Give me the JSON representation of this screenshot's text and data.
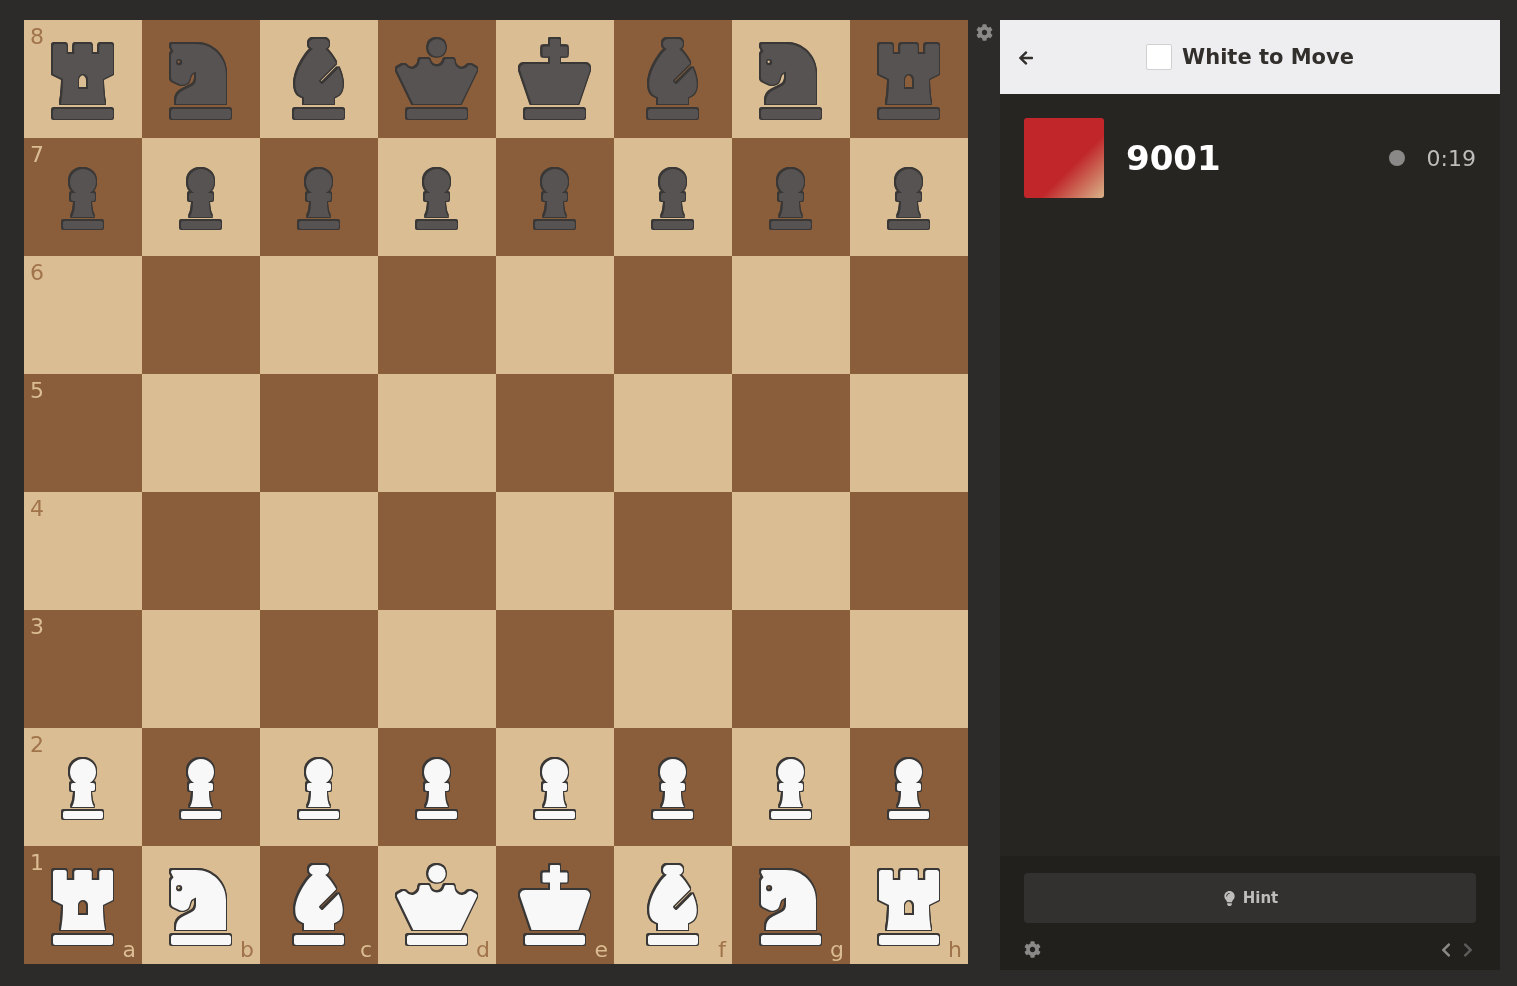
{
  "board": {
    "files": [
      "a",
      "b",
      "c",
      "d",
      "e",
      "f",
      "g",
      "h"
    ],
    "ranks": [
      {
        "label": "8",
        "squares": [
          {
            "kind": "black_rook"
          },
          {
            "kind": "black_knight"
          },
          {
            "kind": "black_bishop"
          },
          {
            "kind": "black_queen"
          },
          {
            "kind": "black_king"
          },
          {
            "kind": "black_bishop"
          },
          {
            "kind": "black_knight"
          },
          {
            "kind": "black_rook"
          }
        ]
      },
      {
        "label": "7",
        "squares": [
          {
            "kind": "black_pawn"
          },
          {
            "kind": "black_pawn"
          },
          {
            "kind": "black_pawn"
          },
          {
            "kind": "black_pawn"
          },
          {
            "kind": "black_pawn"
          },
          {
            "kind": "black_pawn"
          },
          {
            "kind": "black_pawn"
          },
          {
            "kind": "black_pawn"
          }
        ]
      },
      {
        "label": "6",
        "squares": [
          {
            "kind": "empty"
          },
          {
            "kind": "empty"
          },
          {
            "kind": "empty"
          },
          {
            "kind": "empty"
          },
          {
            "kind": "empty"
          },
          {
            "kind": "empty"
          },
          {
            "kind": "empty"
          },
          {
            "kind": "empty"
          }
        ]
      },
      {
        "label": "5",
        "squares": [
          {
            "kind": "empty"
          },
          {
            "kind": "empty"
          },
          {
            "kind": "empty"
          },
          {
            "kind": "empty"
          },
          {
            "kind": "empty"
          },
          {
            "kind": "empty"
          },
          {
            "kind": "empty"
          },
          {
            "kind": "empty"
          }
        ]
      },
      {
        "label": "4",
        "squares": [
          {
            "kind": "empty"
          },
          {
            "kind": "empty"
          },
          {
            "kind": "empty"
          },
          {
            "kind": "empty"
          },
          {
            "kind": "empty"
          },
          {
            "kind": "empty"
          },
          {
            "kind": "empty"
          },
          {
            "kind": "empty"
          }
        ]
      },
      {
        "label": "3",
        "squares": [
          {
            "kind": "empty"
          },
          {
            "kind": "empty"
          },
          {
            "kind": "empty"
          },
          {
            "kind": "empty"
          },
          {
            "kind": "empty"
          },
          {
            "kind": "empty"
          },
          {
            "kind": "empty"
          },
          {
            "kind": "empty"
          }
        ]
      },
      {
        "label": "2",
        "squares": [
          {
            "kind": "white_pawn"
          },
          {
            "kind": "white_pawn"
          },
          {
            "kind": "white_pawn"
          },
          {
            "kind": "white_pawn"
          },
          {
            "kind": "white_pawn"
          },
          {
            "kind": "white_pawn"
          },
          {
            "kind": "white_pawn"
          },
          {
            "kind": "white_pawn"
          }
        ]
      },
      {
        "label": "1",
        "squares": [
          {
            "kind": "white_rook"
          },
          {
            "kind": "white_knight"
          },
          {
            "kind": "white_bishop"
          },
          {
            "kind": "white_queen"
          },
          {
            "kind": "white_king"
          },
          {
            "kind": "white_bishop"
          },
          {
            "kind": "white_knight"
          },
          {
            "kind": "white_rook"
          }
        ]
      }
    ]
  },
  "panel": {
    "header": {
      "title": "White to Move",
      "checked": false
    },
    "player": {
      "name": "9001",
      "clock": "0:19"
    },
    "hint": {
      "label": "Hint"
    },
    "nav": [
      {
        "kind": "previous",
        "disabled": false
      },
      {
        "kind": "next",
        "disabled": true
      }
    ]
  }
}
